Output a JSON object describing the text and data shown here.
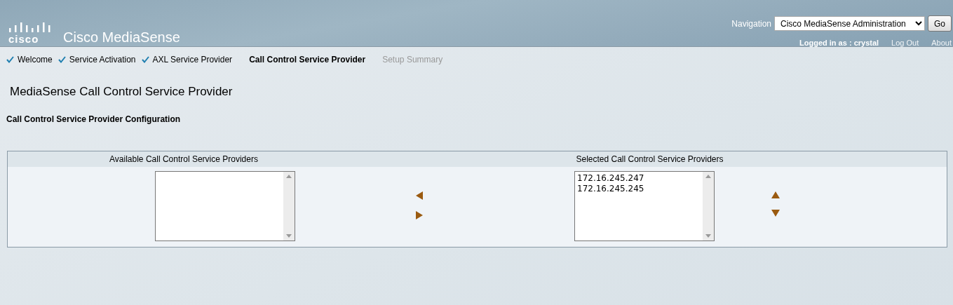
{
  "header": {
    "logo_text": "cisco",
    "product": "Cisco MediaSense",
    "navigation_label": "Navigation",
    "navigation_value": "Cisco MediaSense Administration",
    "go_button": "Go",
    "logged_in": "Logged in as : crystal",
    "links": [
      "Log Out",
      "About"
    ]
  },
  "steps": [
    {
      "label": "Welcome",
      "completed": true,
      "selected": false,
      "disabled": false
    },
    {
      "label": "Service Activation",
      "completed": true,
      "selected": false,
      "disabled": false
    },
    {
      "label": "AXL Service Provider",
      "completed": true,
      "selected": false,
      "disabled": false
    },
    {
      "label": "Call Control Service Provider",
      "completed": false,
      "selected": true,
      "disabled": false
    },
    {
      "label": "Setup Summary",
      "completed": false,
      "selected": false,
      "disabled": true
    }
  ],
  "page_title": "MediaSense Call Control Service Provider",
  "section_title": "Call Control Service Provider Configuration",
  "available": {
    "heading": "Available Call Control Service Providers"
  },
  "selected": {
    "heading": "Selected Call Control Service Providers",
    "items": [
      "172.16.245.247",
      "172.16.245.245"
    ]
  }
}
